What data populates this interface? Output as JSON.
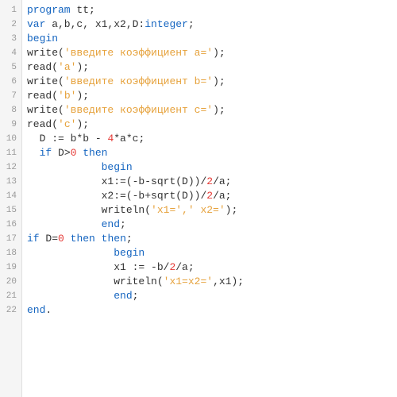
{
  "lines": [
    {
      "num": 1,
      "indent": "",
      "tokens": [
        {
          "t": "program",
          "c": "keyword"
        },
        {
          "t": " ",
          "c": "ident"
        },
        {
          "t": "tt",
          "c": "ident"
        },
        {
          "t": ";",
          "c": "punct"
        }
      ]
    },
    {
      "num": 2,
      "indent": "",
      "tokens": [
        {
          "t": "var",
          "c": "keyword"
        },
        {
          "t": " a,b,c, x1,x2,D:",
          "c": "ident"
        },
        {
          "t": "integer",
          "c": "keyword"
        },
        {
          "t": ";",
          "c": "punct"
        }
      ]
    },
    {
      "num": 3,
      "indent": "",
      "tokens": [
        {
          "t": "begin",
          "c": "keyword"
        }
      ]
    },
    {
      "num": 4,
      "indent": "",
      "tokens": [
        {
          "t": "write",
          "c": "ident"
        },
        {
          "t": "(",
          "c": "punct"
        },
        {
          "t": "'введите коэффициент a='",
          "c": "string"
        },
        {
          "t": ");",
          "c": "punct"
        }
      ]
    },
    {
      "num": 5,
      "indent": "",
      "tokens": [
        {
          "t": "read",
          "c": "ident"
        },
        {
          "t": "(",
          "c": "punct"
        },
        {
          "t": "'a'",
          "c": "string"
        },
        {
          "t": ");",
          "c": "punct"
        }
      ]
    },
    {
      "num": 6,
      "indent": "",
      "tokens": [
        {
          "t": "write",
          "c": "ident"
        },
        {
          "t": "(",
          "c": "punct"
        },
        {
          "t": "'введите коэффициент b='",
          "c": "string"
        },
        {
          "t": ");",
          "c": "punct"
        }
      ]
    },
    {
      "num": 7,
      "indent": "",
      "tokens": [
        {
          "t": "read",
          "c": "ident"
        },
        {
          "t": "(",
          "c": "punct"
        },
        {
          "t": "'b'",
          "c": "string"
        },
        {
          "t": ");",
          "c": "punct"
        }
      ]
    },
    {
      "num": 8,
      "indent": "",
      "tokens": [
        {
          "t": "write",
          "c": "ident"
        },
        {
          "t": "(",
          "c": "punct"
        },
        {
          "t": "'введите коэффициент c='",
          "c": "string"
        },
        {
          "t": ");",
          "c": "punct"
        }
      ]
    },
    {
      "num": 9,
      "indent": "",
      "tokens": [
        {
          "t": "read",
          "c": "ident"
        },
        {
          "t": "(",
          "c": "punct"
        },
        {
          "t": "'c'",
          "c": "string"
        },
        {
          "t": ");",
          "c": "punct"
        }
      ]
    },
    {
      "num": 10,
      "indent": "  ",
      "tokens": [
        {
          "t": "D := b*b - ",
          "c": "ident"
        },
        {
          "t": "4",
          "c": "number"
        },
        {
          "t": "*a*c;",
          "c": "ident"
        }
      ]
    },
    {
      "num": 11,
      "indent": "  ",
      "tokens": [
        {
          "t": "if",
          "c": "keyword"
        },
        {
          "t": " D>",
          "c": "ident"
        },
        {
          "t": "0",
          "c": "number"
        },
        {
          "t": " ",
          "c": "ident"
        },
        {
          "t": "then",
          "c": "keyword"
        }
      ]
    },
    {
      "num": 12,
      "indent": "            ",
      "tokens": [
        {
          "t": "begin",
          "c": "keyword"
        }
      ]
    },
    {
      "num": 13,
      "indent": "            ",
      "tokens": [
        {
          "t": "x1:=(-b-sqrt(D))/",
          "c": "ident"
        },
        {
          "t": "2",
          "c": "number"
        },
        {
          "t": "/a;",
          "c": "ident"
        }
      ]
    },
    {
      "num": 14,
      "indent": "            ",
      "tokens": [
        {
          "t": "x2:=(-b+sqrt(D))/",
          "c": "ident"
        },
        {
          "t": "2",
          "c": "number"
        },
        {
          "t": "/a;",
          "c": "ident"
        }
      ]
    },
    {
      "num": 15,
      "indent": "            ",
      "tokens": [
        {
          "t": "writeln(",
          "c": "ident"
        },
        {
          "t": "'x1=','",
          "c": "string"
        },
        {
          "t": " x2='",
          "c": "string"
        },
        {
          "t": ");",
          "c": "punct"
        }
      ]
    },
    {
      "num": 16,
      "indent": "            ",
      "tokens": [
        {
          "t": "end",
          "c": "keyword"
        },
        {
          "t": ";",
          "c": "punct"
        }
      ]
    },
    {
      "num": 17,
      "indent": "",
      "tokens": [
        {
          "t": "if",
          "c": "keyword"
        },
        {
          "t": " D=",
          "c": "ident"
        },
        {
          "t": "0",
          "c": "number"
        },
        {
          "t": " ",
          "c": "ident"
        },
        {
          "t": "then",
          "c": "keyword"
        },
        {
          "t": " ",
          "c": "ident"
        },
        {
          "t": "then",
          "c": "keyword"
        },
        {
          "t": ";",
          "c": "punct"
        }
      ]
    },
    {
      "num": 18,
      "indent": "              ",
      "tokens": [
        {
          "t": "begin",
          "c": "keyword"
        }
      ]
    },
    {
      "num": 19,
      "indent": "              ",
      "tokens": [
        {
          "t": "x1 := -b/",
          "c": "ident"
        },
        {
          "t": "2",
          "c": "number"
        },
        {
          "t": "/a;",
          "c": "ident"
        }
      ]
    },
    {
      "num": 20,
      "indent": "              ",
      "tokens": [
        {
          "t": "writeln(",
          "c": "ident"
        },
        {
          "t": "'x1=x2='",
          "c": "string"
        },
        {
          "t": ",x1);",
          "c": "ident"
        }
      ]
    },
    {
      "num": 21,
      "indent": "              ",
      "tokens": [
        {
          "t": "end",
          "c": "keyword"
        },
        {
          "t": ";",
          "c": "punct"
        }
      ]
    },
    {
      "num": 22,
      "indent": "",
      "tokens": [
        {
          "t": "end",
          "c": "keyword"
        },
        {
          "t": ".",
          "c": "punct"
        }
      ]
    }
  ]
}
